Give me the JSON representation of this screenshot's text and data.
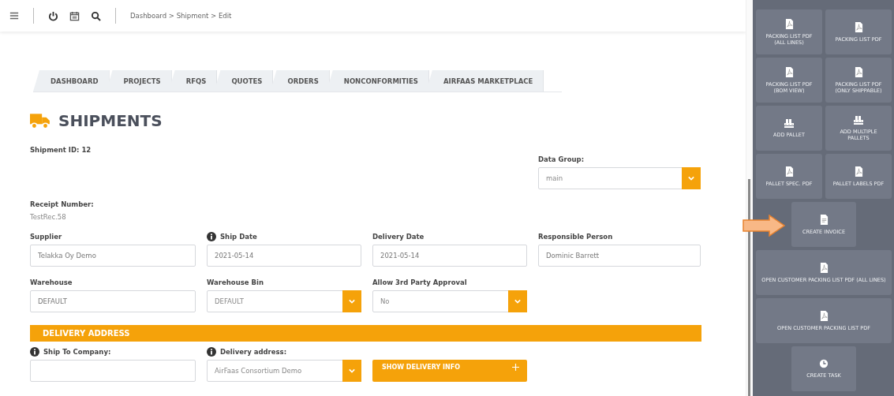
{
  "top_bar": {
    "breadcrumb": "Dashboard > Shipment > Edit"
  },
  "tabs": [
    {
      "label": "DASHBOARD"
    },
    {
      "label": "PROJECTS"
    },
    {
      "label": "RFQS"
    },
    {
      "label": "QUOTES"
    },
    {
      "label": "ORDERS"
    },
    {
      "label": "NONCONFORMITIES"
    },
    {
      "label": "AIRFAAS MARKETPLACE"
    }
  ],
  "page_title": "SHIPMENTS",
  "shipment_id": "Shipment ID: 12",
  "data_group": {
    "label": "Data Group:",
    "value": "main",
    "kind": "select",
    "info": false
  },
  "receipt": {
    "label": "Receipt Number:",
    "value": "TestRec.58"
  },
  "field_rows": [
    [
      {
        "label": "Supplier",
        "value": "Telakka Oy Demo",
        "kind": "input",
        "info": false
      },
      {
        "label": "Ship Date",
        "value": "2021-05-14",
        "kind": "input",
        "info": true
      },
      {
        "label": "Delivery Date",
        "value": "2021-05-14",
        "kind": "input",
        "info": false
      },
      {
        "label": "Responsible Person",
        "value": "Dominic Barrett",
        "kind": "input",
        "info": false
      }
    ],
    [
      {
        "label": "Warehouse",
        "value": "DEFAULT",
        "kind": "input",
        "info": false
      },
      {
        "label": "Warehouse Bin",
        "value": "DEFAULT",
        "kind": "select",
        "info": false
      },
      {
        "label": "Allow 3rd Party Approval",
        "value": "No",
        "kind": "select",
        "info": false
      }
    ]
  ],
  "delivery_address": {
    "title": "DELIVERY ADDRESS",
    "fields": [
      {
        "label": "Ship To Company:",
        "kind": "input",
        "info": true
      },
      {
        "label": "Delivery address:",
        "value": "AirFaas Consortium Demo",
        "kind": "select",
        "info": true
      },
      {
        "label": "SHOW DELIVERY INFO",
        "kind": "button",
        "info": false
      }
    ]
  },
  "actions": [
    {
      "label": "PACKING LIST PDF (ALL LINES)",
      "kind": "pdf",
      "pointed": false
    },
    {
      "label": "PACKING LIST PDF",
      "kind": "pdf",
      "pointed": false
    },
    {
      "label": "PACKING LIST PDF (BOM VIEW)",
      "kind": "pdf",
      "pointed": false
    },
    {
      "label": "PACKING LIST PDF (ONLY SHIPPABLE)",
      "kind": "pdf",
      "pointed": false
    },
    {
      "label": "ADD PALLET",
      "kind": "pallet",
      "pointed": false
    },
    {
      "label": "ADD MULTIPLE PALLETS",
      "kind": "pallet",
      "pointed": false
    },
    {
      "label": "PALLET SPEC. PDF",
      "kind": "pdf",
      "pointed": false
    },
    {
      "label": "PALLET LABELS PDF",
      "kind": "pdf",
      "pointed": false
    },
    {
      "label": "CREATE INVOICE",
      "kind": "invoice",
      "pointed": true
    },
    {
      "label": "OPEN CUSTOMER PACKING LIST PDF (ALL LINES)",
      "kind": "customerpdf",
      "pointed": false
    },
    {
      "label": "OPEN CUSTOMER PACKING LIST PDF",
      "kind": "customerpdf",
      "pointed": false
    },
    {
      "label": "CREATE TASK",
      "kind": "task",
      "pointed": false
    }
  ]
}
